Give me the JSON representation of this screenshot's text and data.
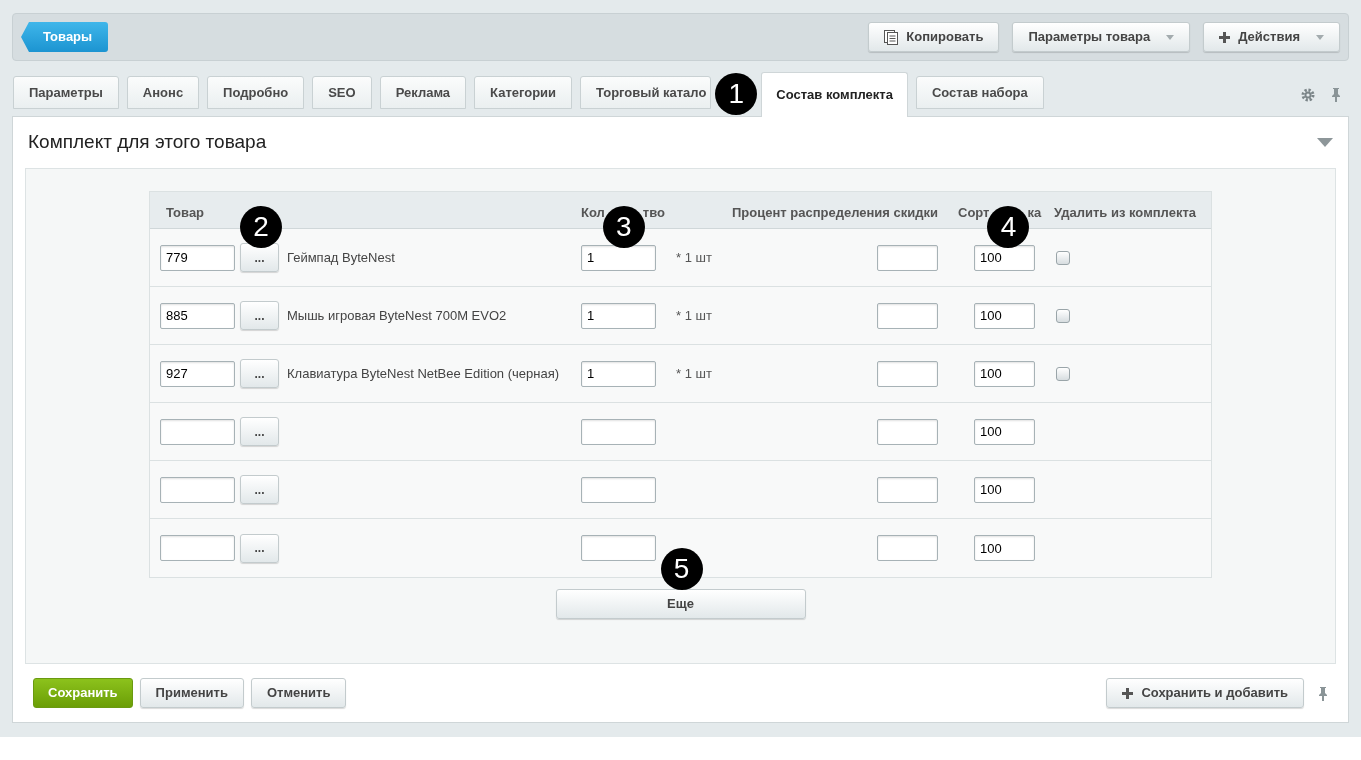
{
  "back_button": "Товары",
  "toolbar": [
    {
      "kind": "copy",
      "label": "Копировать"
    },
    {
      "kind": "menu",
      "label": "Параметры товара"
    },
    {
      "kind": "add-menu",
      "label": "Действия"
    }
  ],
  "tabs": [
    {
      "label": "Параметры",
      "selected": false
    },
    {
      "label": "Анонс",
      "selected": false
    },
    {
      "label": "Подробно",
      "selected": false
    },
    {
      "label": "SEO",
      "selected": false
    },
    {
      "label": "Реклама",
      "selected": false
    },
    {
      "label": "Категории",
      "selected": false
    },
    {
      "label": "Торговый катало",
      "selected": false
    },
    {
      "label": "Состав комплекта",
      "selected": true,
      "callout": "1"
    },
    {
      "label": "Состав набора",
      "selected": false
    }
  ],
  "section": {
    "title": "Комплект для этого товара",
    "expanded": true
  },
  "table": {
    "columns": [
      {
        "label": "Товар",
        "callout": "2"
      },
      {
        "label_parts": [
          "Кол",
          "тво"
        ],
        "callout": "3"
      },
      {
        "label": "Процент распределения скидки"
      },
      {
        "label_parts": [
          "Сорт",
          "ка"
        ],
        "callout": "4"
      },
      {
        "label": "Удалить из комплекта"
      }
    ],
    "rows": [
      {
        "product_id": "779",
        "picker": "...",
        "name": "Геймпад ByteNest",
        "quantity": "1",
        "unit": "* 1 шт",
        "sort": "100",
        "delete_checked": false
      },
      {
        "product_id": "885",
        "picker": "...",
        "name": "Мышь игровая ByteNest 700M EVO2",
        "quantity": "1",
        "unit": "* 1 шт",
        "sort": "100",
        "delete_checked": false
      },
      {
        "product_id": "927",
        "picker": "...",
        "name": "Клавиатура ByteNest NetBee Edition (черная)",
        "quantity": "1",
        "unit": "* 1 шт",
        "sort": "100",
        "delete_checked": false
      },
      {
        "picker": "...",
        "sort": "100"
      },
      {
        "picker": "...",
        "sort": "100"
      },
      {
        "picker": "...",
        "sort": "100"
      }
    ]
  },
  "more_button": {
    "label": "Еще",
    "callout": "5"
  },
  "footer": {
    "buttons": [
      {
        "kind": "primary",
        "label": "Сохранить"
      },
      {
        "kind": "default",
        "label": "Применить"
      },
      {
        "kind": "default",
        "label": "Отменить"
      }
    ],
    "save_and_add": "Сохранить и добавить"
  }
}
